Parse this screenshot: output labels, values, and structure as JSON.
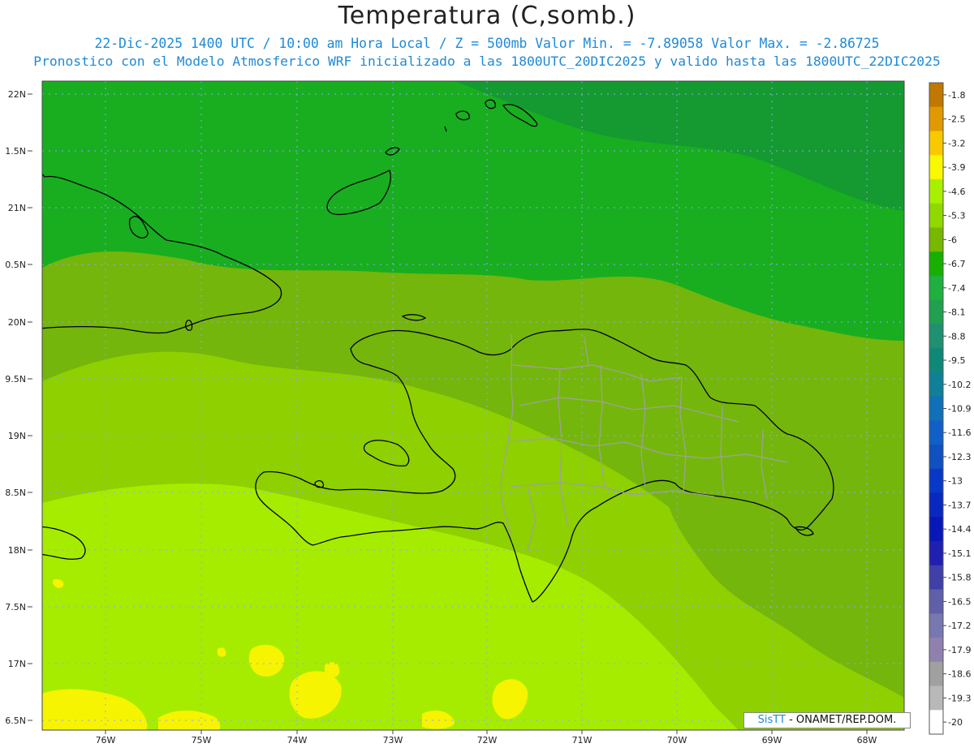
{
  "header": {
    "title": "Temperatura (C,somb.)",
    "line1": "22-Dic-2025  1400 UTC / 10:00 am Hora Local / Z = 500mb  Valor Min. = -7.89058  Valor Max. = -2.86725",
    "line2": "Pronostico con el Modelo Atmosferico WRF inicializado a las 1800UTC_20DIC2025 y valido hasta las  1800UTC_22DIC2025"
  },
  "map": {
    "lat_labels": [
      "22N",
      "1.5N",
      "21N",
      "0.5N",
      "20N",
      "9.5N",
      "19N",
      "8.5N",
      "18N",
      "7.5N",
      "17N",
      "6.5N"
    ],
    "lon_labels": [
      "76W",
      "75W",
      "74W",
      "73W",
      "72W",
      "71W",
      "70W",
      "69W",
      "68W"
    ],
    "regions": [
      "Cuba (east)",
      "Haiti",
      "Republica Dominicana",
      "Jamaica",
      "Bahamas (south)",
      "Turks and Caicos"
    ]
  },
  "colorbar": {
    "labels": [
      "-1.8",
      "-2.5",
      "-3.2",
      "-3.9",
      "-4.6",
      "-5.3",
      "-6",
      "-6.7",
      "-7.4",
      "-8.1",
      "-8.8",
      "-9.5",
      "-10.2",
      "-10.9",
      "-11.6",
      "-12.3",
      "-13",
      "-13.7",
      "-14.4",
      "-15.1",
      "-15.8",
      "-16.5",
      "-17.2",
      "-17.9",
      "-18.6",
      "-19.3",
      "-20"
    ],
    "colors": [
      "#c07800",
      "#e09a00",
      "#f8c800",
      "#f8f800",
      "#a8f000",
      "#90d800",
      "#78b800",
      "#18b000",
      "#20b040",
      "#20a050",
      "#209070",
      "#108878",
      "#108098",
      "#1070b8",
      "#1060c8",
      "#1050c0",
      "#0838c8",
      "#0828c0",
      "#0818b8",
      "#2020b0",
      "#4040a8",
      "#6060a8",
      "#7878b0",
      "#9080b0",
      "#a0a0a0",
      "#b8b8b8",
      "#ffffff"
    ]
  },
  "credit": {
    "brand": "SisTT",
    "rest": " - ONAMET/REP.DOM."
  }
}
